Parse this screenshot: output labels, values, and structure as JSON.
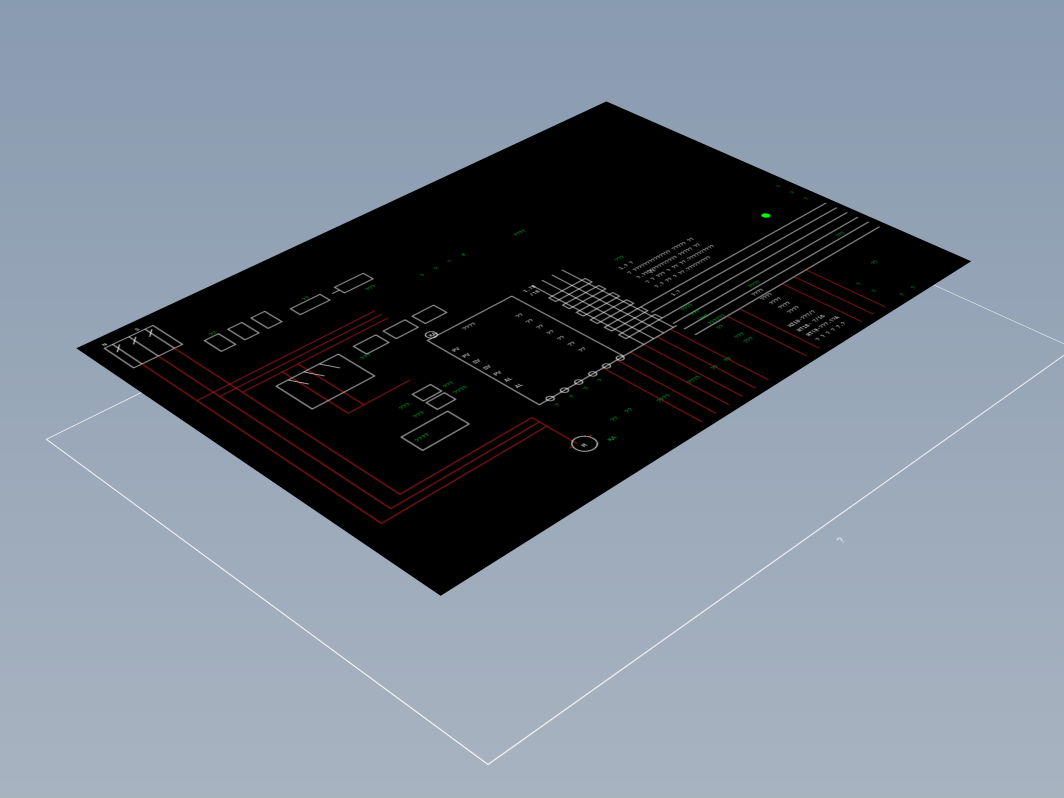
{
  "domain": "Diagram",
  "title": "?",
  "colors": {
    "bg_gradient_top": "#899bb0",
    "bg_gradient_bottom": "#a8b3c0",
    "sheet": "#000000",
    "wire_power": "#d21f1f",
    "wire_signal": "#ffffff",
    "annotation": "#00cc33",
    "frame": "#ffffff"
  },
  "schematic": {
    "header_labels": [
      "?",
      "?",
      "7",
      "4",
      "????"
    ],
    "component_labels": {
      "top_left": [
        "N",
        "S",
        "???"
      ],
      "power_rails": [
        "??",
        "??",
        "???"
      ],
      "motor": "M",
      "io_block": {
        "left": [
          "PV",
          "PV",
          "SV",
          "SV",
          "PV",
          "AL",
          "AL"
        ],
        "right": [
          "??",
          "??",
          "??",
          "??",
          "??",
          "??",
          "??"
        ],
        "heading": "????",
        "model": "1.78",
        "rev": "/18"
      },
      "notes_right": {
        "heading": "???",
        "lines": [
          "1.?   ?",
          "? ?????????????? ????? ??",
          "?.??QQ????????? ????? ??",
          "? ? ???  ? ?? ??.??????????",
          "?.?    ?? ? ??.?????????",
          "1.?",
          "????"
        ]
      },
      "parts_list": {
        "heading": "????",
        "rows": [
          "????",
          "????",
          "????",
          "????",
          "????"
        ],
        "footer": [
          "HZ10-???/?",
          "RT18- ?/16",
          "RT18-???.1?A",
          "? ? ?  ? ?.?"
        ]
      },
      "bottom_labels": [
        "??",
        "??",
        "KA",
        "????",
        "????",
        "??",
        "??",
        "??",
        "??",
        "??"
      ],
      "terminal_row": [
        "?",
        "?",
        "?",
        "?",
        "?",
        "?",
        "?",
        "?"
      ],
      "right_margin": [
        "?",
        "?",
        "?",
        "???",
        "??",
        "?",
        "?",
        "?",
        "?"
      ]
    }
  }
}
